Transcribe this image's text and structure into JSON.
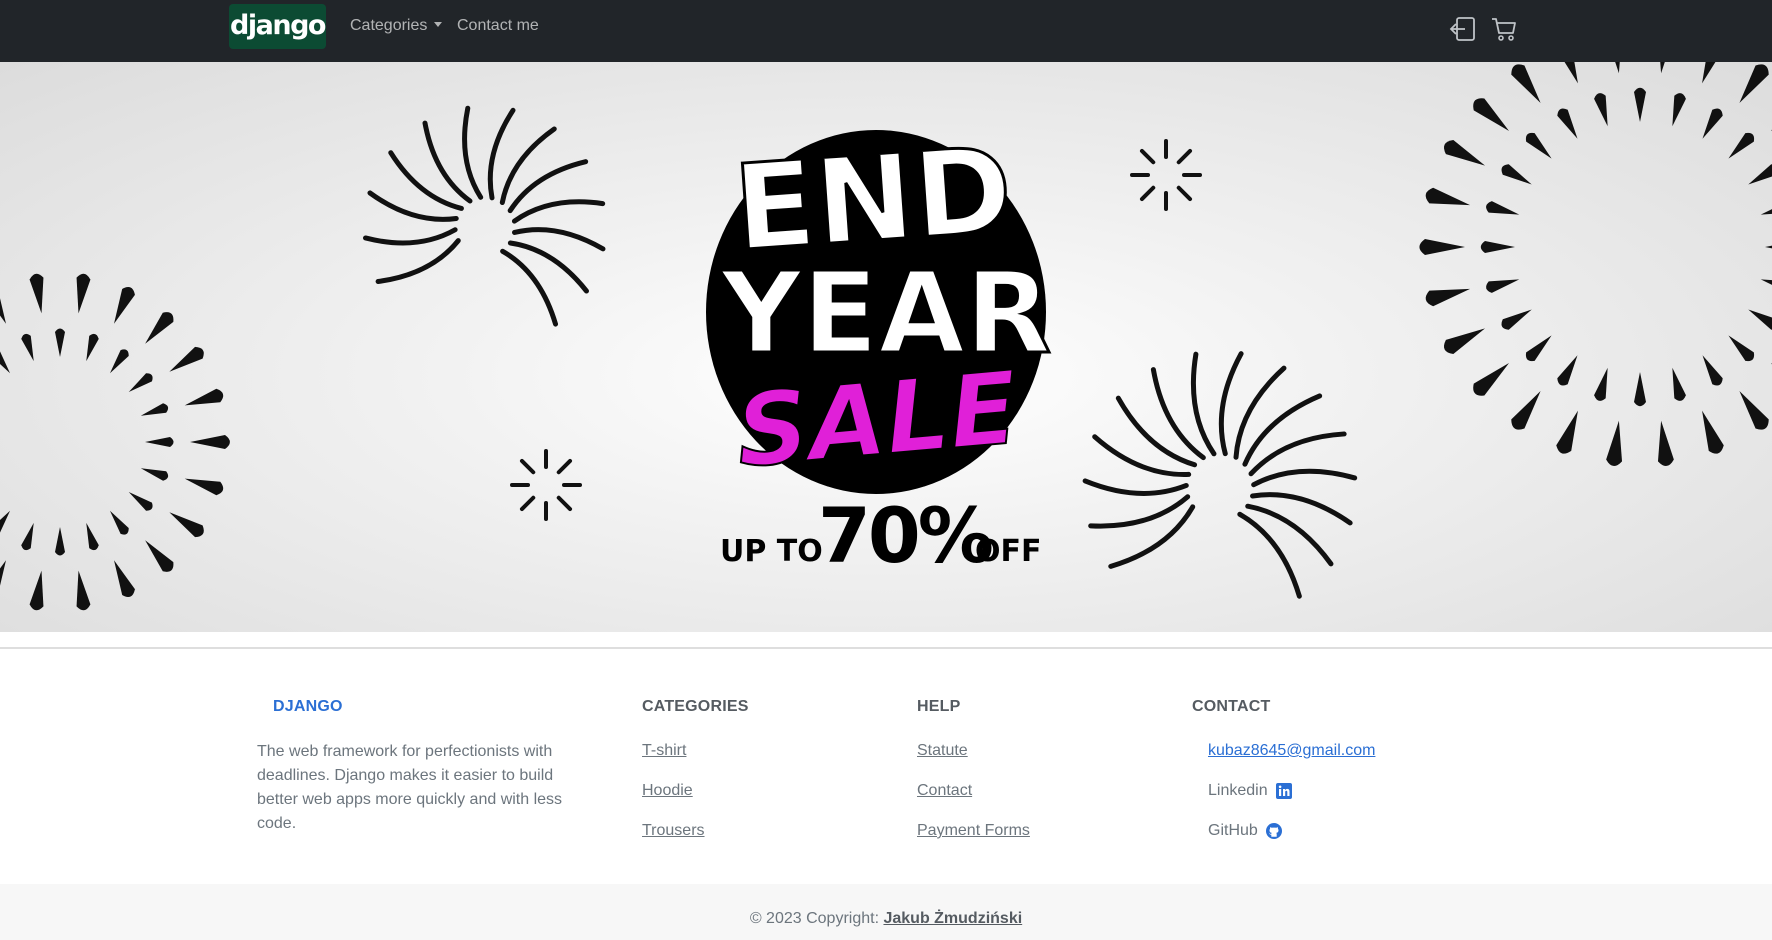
{
  "navbar": {
    "brand": "django",
    "categories_label": "Categories",
    "contact_label": "Contact me",
    "icons": [
      "login-icon",
      "cart-icon"
    ]
  },
  "hero": {
    "line1": "END",
    "line2": "YEAR",
    "line3": "SALE",
    "offer_prefix": "UP TO",
    "offer_value": "70%",
    "offer_suffix": "OFF",
    "accent_color": "#e020d8"
  },
  "footer": {
    "brand_heading": "DJANGO",
    "about": "The web framework for perfectionists with deadlines. Django makes it easier to build better web apps more quickly and with less code.",
    "categories_heading": "CATEGORIES",
    "categories": [
      "T-shirt",
      "Hoodie",
      "Trousers"
    ],
    "help_heading": "HELP",
    "help": [
      "Statute",
      "Contact",
      "Payment Forms"
    ],
    "contact_heading": "CONTACT",
    "email": "kubaz8645@gmail.com",
    "linkedin": "Linkedin",
    "github": "GitHub",
    "link_color": "#2b6fd4"
  },
  "copyright": {
    "text": "© 2023 Copyright:",
    "author": "Jakub Żmudziński"
  }
}
